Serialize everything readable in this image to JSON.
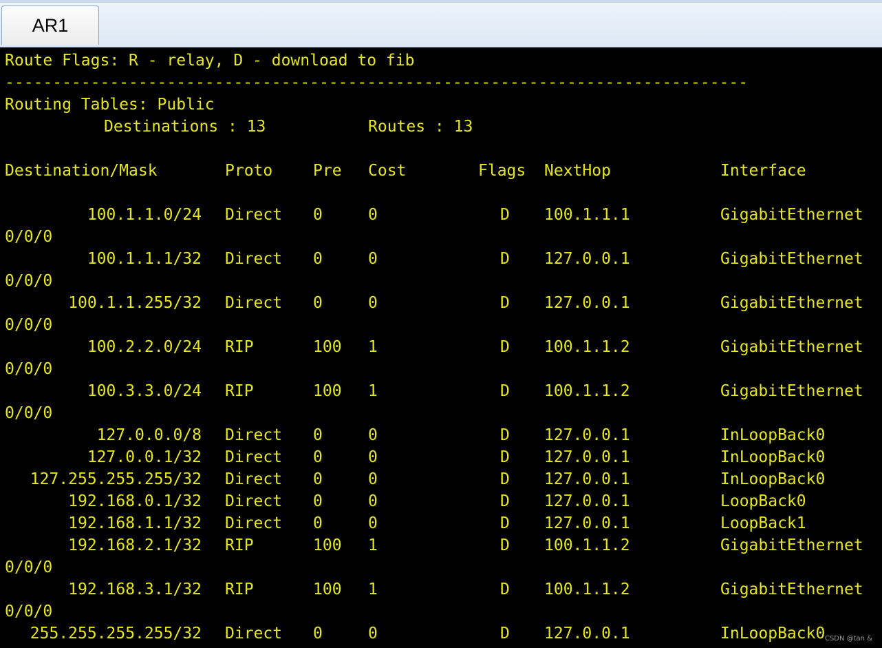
{
  "tab": {
    "label": "AR1"
  },
  "terminal": {
    "flags_line": "Route Flags: R - relay, D - download to fib",
    "separator": "------------------------------------------------------------------------------",
    "tables_line": "Routing Tables: Public",
    "destinations_label": "Destinations : 13",
    "routes_label": "Routes : 13",
    "headers": {
      "destination": "Destination/Mask",
      "proto": "Proto",
      "pre": "Pre",
      "cost": "Cost",
      "flags": "Flags",
      "nexthop": "NextHop",
      "interface": "Interface"
    },
    "rows": [
      {
        "dest": "100.1.1.0/24",
        "proto": "Direct",
        "pre": "0",
        "cost": "0",
        "flags": "D",
        "nexthop": "100.1.1.1",
        "iface": "GigabitEthernet",
        "iface_cont": "0/0/0"
      },
      {
        "dest": "100.1.1.1/32",
        "proto": "Direct",
        "pre": "0",
        "cost": "0",
        "flags": "D",
        "nexthop": "127.0.0.1",
        "iface": "GigabitEthernet",
        "iface_cont": "0/0/0"
      },
      {
        "dest": "100.1.1.255/32",
        "proto": "Direct",
        "pre": "0",
        "cost": "0",
        "flags": "D",
        "nexthop": "127.0.0.1",
        "iface": "GigabitEthernet",
        "iface_cont": "0/0/0"
      },
      {
        "dest": "100.2.2.0/24",
        "proto": "RIP",
        "pre": "100",
        "cost": "1",
        "flags": "D",
        "nexthop": "100.1.1.2",
        "iface": "GigabitEthernet",
        "iface_cont": "0/0/0"
      },
      {
        "dest": "100.3.3.0/24",
        "proto": "RIP",
        "pre": "100",
        "cost": "1",
        "flags": "D",
        "nexthop": "100.1.1.2",
        "iface": "GigabitEthernet",
        "iface_cont": "0/0/0"
      },
      {
        "dest": "127.0.0.0/8",
        "proto": "Direct",
        "pre": "0",
        "cost": "0",
        "flags": "D",
        "nexthop": "127.0.0.1",
        "iface": "InLoopBack0",
        "iface_cont": ""
      },
      {
        "dest": "127.0.0.1/32",
        "proto": "Direct",
        "pre": "0",
        "cost": "0",
        "flags": "D",
        "nexthop": "127.0.0.1",
        "iface": "InLoopBack0",
        "iface_cont": ""
      },
      {
        "dest": "127.255.255.255/32",
        "proto": "Direct",
        "pre": "0",
        "cost": "0",
        "flags": "D",
        "nexthop": "127.0.0.1",
        "iface": "InLoopBack0",
        "iface_cont": ""
      },
      {
        "dest": "192.168.0.1/32",
        "proto": "Direct",
        "pre": "0",
        "cost": "0",
        "flags": "D",
        "nexthop": "127.0.0.1",
        "iface": "LoopBack0",
        "iface_cont": ""
      },
      {
        "dest": "192.168.1.1/32",
        "proto": "Direct",
        "pre": "0",
        "cost": "0",
        "flags": "D",
        "nexthop": "127.0.0.1",
        "iface": "LoopBack1",
        "iface_cont": ""
      },
      {
        "dest": "192.168.2.1/32",
        "proto": "RIP",
        "pre": "100",
        "cost": "1",
        "flags": "D",
        "nexthop": "100.1.1.2",
        "iface": "GigabitEthernet",
        "iface_cont": "0/0/0"
      },
      {
        "dest": "192.168.3.1/32",
        "proto": "RIP",
        "pre": "100",
        "cost": "1",
        "flags": "D",
        "nexthop": "100.1.1.2",
        "iface": "GigabitEthernet",
        "iface_cont": "0/0/0"
      },
      {
        "dest": "255.255.255.255/32",
        "proto": "Direct",
        "pre": "0",
        "cost": "0",
        "flags": "D",
        "nexthop": "127.0.0.1",
        "iface": "InLoopBack0",
        "iface_cont": ""
      }
    ]
  },
  "watermark": "CSDN @tan &",
  "colors": {
    "terminal_text": "#e6e619",
    "terminal_bg": "#000000"
  }
}
